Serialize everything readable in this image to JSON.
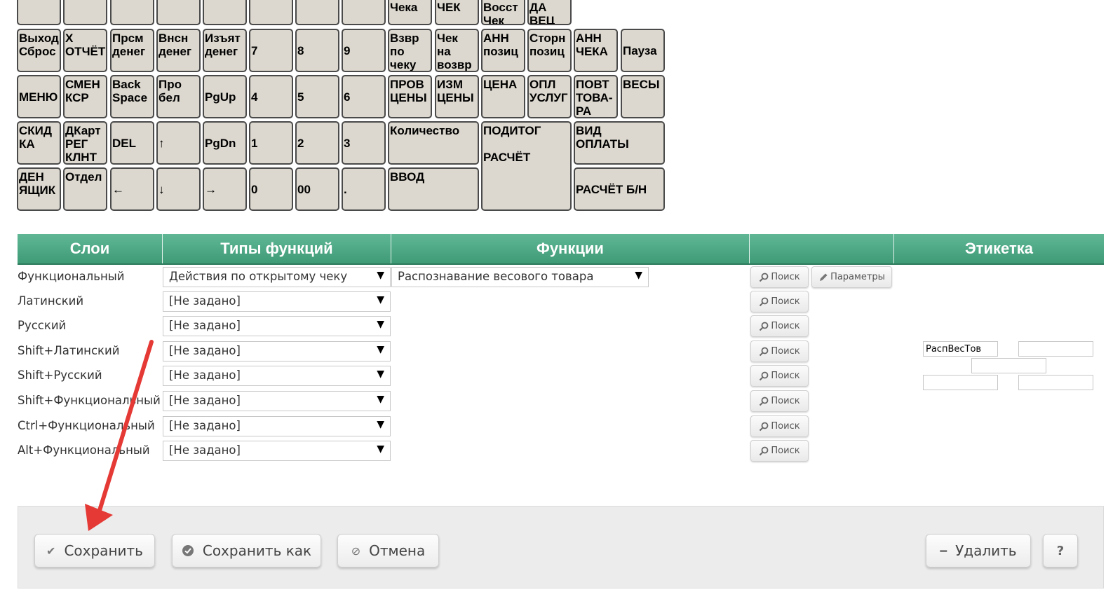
{
  "keyboard": {
    "keys": [
      {
        "label": ""
      },
      {
        "label": ""
      },
      {
        "label": ""
      },
      {
        "label": ""
      },
      {
        "label": ""
      },
      {
        "label": ""
      },
      {
        "label": ""
      },
      {
        "label": ""
      },
      {
        "label": "Чека"
      },
      {
        "label": "ЧЕК"
      },
      {
        "label": "Восст\nЧек"
      },
      {
        "label": "ДА\nВЕЦ"
      },
      {
        "label": "Выход\nСброс"
      },
      {
        "label": "X\nОТЧЁТ"
      },
      {
        "label": "Прсм\nденег"
      },
      {
        "label": "Внсн\nденег"
      },
      {
        "label": "Изъят\nденег"
      },
      {
        "label": "7"
      },
      {
        "label": "8"
      },
      {
        "label": "9"
      },
      {
        "label": "Взвр\nпо\nчеку"
      },
      {
        "label": "Чек\nна\nвозвр"
      },
      {
        "label": "АНН\nпозиц"
      },
      {
        "label": "Сторн\nпозиц"
      },
      {
        "label": "АНН\nЧЕКА"
      },
      {
        "label": "Пауза"
      },
      {
        "label": "МЕНЮ"
      },
      {
        "label": "СМЕН\nКСР"
      },
      {
        "label": "Back\nSpace"
      },
      {
        "label": "Про\nбел"
      },
      {
        "label": "PgUp"
      },
      {
        "label": "4"
      },
      {
        "label": "5"
      },
      {
        "label": "6"
      },
      {
        "label": "ПРОВ\nЦЕНЫ"
      },
      {
        "label": "ИЗМ\nЦЕНЫ"
      },
      {
        "label": "ЦЕНА"
      },
      {
        "label": "ОПЛ\nУСЛУГ"
      },
      {
        "label": "ПОВТ\nТОВА-\nРА"
      },
      {
        "label": "ВЕСЫ"
      },
      {
        "label": "СКИД\nКА"
      },
      {
        "label": "ДКарт\nРЕГ\nКЛНТ"
      },
      {
        "label": "DEL"
      },
      {
        "label": "↑"
      },
      {
        "label": "PgDn"
      },
      {
        "label": "1"
      },
      {
        "label": "2"
      },
      {
        "label": "3"
      },
      {
        "label": "Количество"
      },
      {
        "label": "ПОДИТОГ\n\nРАСЧЁТ"
      },
      {
        "label": "ВИД\nОПЛАТЫ"
      },
      {
        "label": "ДЕН\nЯЩИК"
      },
      {
        "label": "Отдел"
      },
      {
        "label": "←"
      },
      {
        "label": "↓"
      },
      {
        "label": "→"
      },
      {
        "label": "0"
      },
      {
        "label": "00"
      },
      {
        "label": "."
      },
      {
        "label": "ВВОД"
      },
      {
        "label": "РАСЧЁТ Б/Н"
      }
    ]
  },
  "table": {
    "headers": {
      "layers": "Слои",
      "function_types": "Типы функций",
      "functions": "Функции",
      "actions": "",
      "label": "Этикетка"
    },
    "rows": [
      {
        "layer": "Функциональный",
        "type": "Действия по открытому чеку",
        "function": "Распознавание весового товара",
        "search": "Поиск",
        "params": "Параметры"
      },
      {
        "layer": "Латинский",
        "type": "[Не задано]",
        "search": "Поиск"
      },
      {
        "layer": "Русский",
        "type": "[Не задано]",
        "search": "Поиск"
      },
      {
        "layer": "Shift+Латинский",
        "type": "[Не задано]",
        "search": "Поиск"
      },
      {
        "layer": "Shift+Русский",
        "type": "[Не задано]",
        "search": "Поиск"
      },
      {
        "layer": "Shift+Функциональный",
        "type": "[Не задано]",
        "search": "Поиск"
      },
      {
        "layer": "Ctrl+Функциональный",
        "type": "[Не задано]",
        "search": "Поиск"
      },
      {
        "layer": "Alt+Функциональный",
        "type": "[Не задано]",
        "search": "Поиск"
      }
    ],
    "label_fields": {
      "top_left": "РаспВесТов",
      "top_right": "",
      "middle": "",
      "bottom_left": "",
      "bottom_right": ""
    }
  },
  "footer": {
    "save": "Сохранить",
    "save_as": "Сохранить как",
    "cancel": "Отмена",
    "delete": "Удалить",
    "help": "?"
  },
  "icons": {
    "search": "magnifier-icon",
    "params": "pencil-icon",
    "save": "check-icon",
    "save_as": "check-circle-icon",
    "cancel": "cancel-circle-icon",
    "delete": "minus-icon"
  },
  "colors": {
    "header_green": "#4fa985",
    "key_fill": "#dcd8cf",
    "arrow": "#e53935"
  }
}
